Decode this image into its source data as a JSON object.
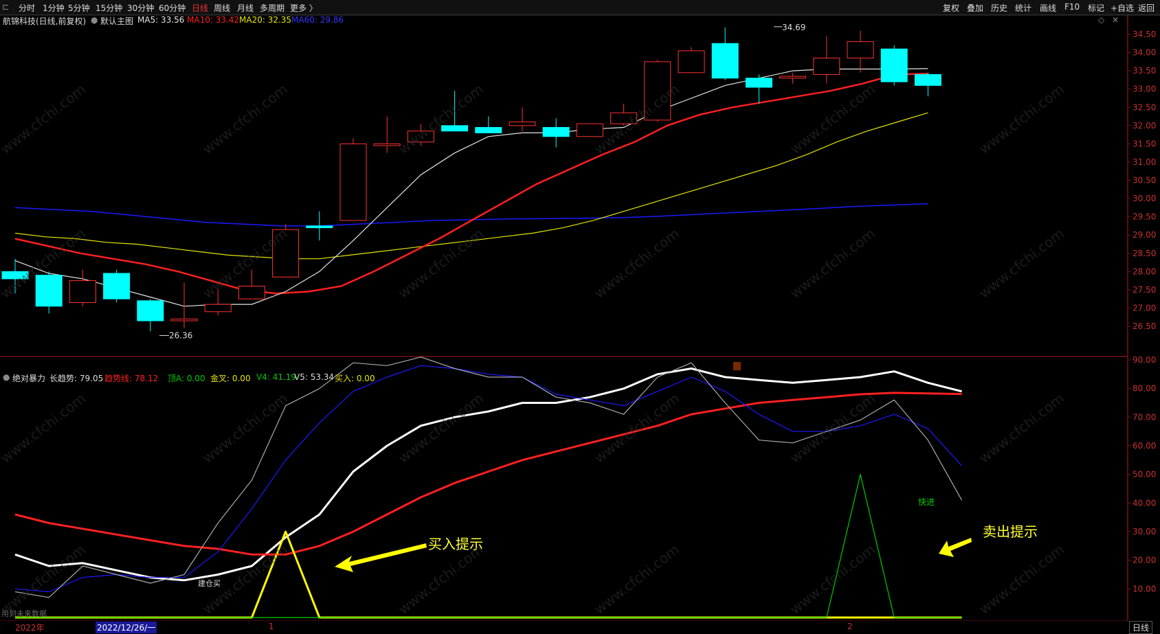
{
  "periods": [
    "分时",
    "1分钟",
    "5分钟",
    "15分钟",
    "30分钟",
    "60分钟",
    "日线",
    "周线",
    "月线",
    "多周期",
    "更多 〉"
  ],
  "active_period": "日线",
  "top_buttons": [
    "复权",
    "叠加",
    "历史",
    "统计",
    "画线",
    "F10",
    "标记",
    "+自选",
    "返回"
  ],
  "stock": {
    "name": "航锦科技(日线,前复权)",
    "main_label": "默认主图",
    "ma5_label": "MA5: 33.56",
    "ma10_label": "MA10: 33.42",
    "ma20_label": "MA20: 32.35",
    "ma60_label": "MA60: 29.86"
  },
  "indicator": {
    "name": "绝对暴力",
    "long_label": "长趋势: 79.05",
    "trend_label": "趋势线: 78.12",
    "top_label": "顶A: 0.00",
    "gold_label": "金叉: 0.00",
    "v4_label": "V4: 41.19",
    "v5_label": "V5: 53.34",
    "buy_label": "买入: 0.00"
  },
  "annotations": {
    "buy_hint": "买入提示",
    "sell_hint": "卖出提示",
    "fast_in": "快进",
    "low_label": "26.36",
    "high_label": "34.69",
    "bottom_note": "用到未来数据",
    "small_label": "建仓买"
  },
  "watermark": "www.cfchi.com",
  "bottom": {
    "year": "2022年",
    "cursor_date": "2022/12/26/一",
    "m1": "1",
    "m2": "2",
    "tab": "日线"
  },
  "colors": {
    "up": "#ff3232",
    "down": "#00ffff",
    "ma5": "#e6e6e6",
    "ma10": "#ff2020",
    "ma20": "#e6e600",
    "ma60": "#1a1aff",
    "grid": "#7a1010",
    "axis_text": "#c83232"
  },
  "chart_data": [
    {
      "type": "candlestick",
      "title": "航锦科技(日线,前复权)",
      "ylim": [
        26.2,
        34.85
      ],
      "yticks": [
        26.5,
        27.0,
        27.5,
        28.0,
        28.5,
        29.0,
        29.5,
        30.0,
        30.5,
        31.0,
        31.5,
        32.0,
        32.5,
        33.0,
        33.5,
        34.0,
        34.5
      ],
      "candles": [
        {
          "o": 28.0,
          "h": 28.35,
          "l": 27.4,
          "c": 27.8
        },
        {
          "o": 27.9,
          "h": 28.0,
          "l": 26.85,
          "c": 27.05
        },
        {
          "o": 27.15,
          "h": 28.05,
          "l": 27.05,
          "c": 27.75
        },
        {
          "o": 27.95,
          "h": 28.05,
          "l": 27.15,
          "c": 27.25
        },
        {
          "o": 27.2,
          "h": 27.25,
          "l": 26.36,
          "c": 26.65
        },
        {
          "o": 26.65,
          "h": 27.7,
          "l": 26.45,
          "c": 26.7
        },
        {
          "o": 26.9,
          "h": 27.5,
          "l": 26.8,
          "c": 27.1
        },
        {
          "o": 27.25,
          "h": 28.05,
          "l": 27.25,
          "c": 27.6
        },
        {
          "o": 27.85,
          "h": 29.3,
          "l": 27.85,
          "c": 29.15
        },
        {
          "o": 29.25,
          "h": 29.65,
          "l": 28.85,
          "c": 29.2
        },
        {
          "o": 29.4,
          "h": 31.65,
          "l": 29.4,
          "c": 31.5
        },
        {
          "o": 31.45,
          "h": 32.25,
          "l": 31.25,
          "c": 31.5
        },
        {
          "o": 31.55,
          "h": 32.05,
          "l": 31.45,
          "c": 31.85
        },
        {
          "o": 32.0,
          "h": 32.95,
          "l": 31.85,
          "c": 31.85
        },
        {
          "o": 31.95,
          "h": 32.25,
          "l": 31.8,
          "c": 31.8
        },
        {
          "o": 32.0,
          "h": 32.5,
          "l": 31.85,
          "c": 32.1
        },
        {
          "o": 31.95,
          "h": 32.2,
          "l": 31.4,
          "c": 31.7
        },
        {
          "o": 31.7,
          "h": 32.05,
          "l": 31.7,
          "c": 32.05
        },
        {
          "o": 32.05,
          "h": 32.6,
          "l": 32.0,
          "c": 32.35
        },
        {
          "o": 32.15,
          "h": 33.8,
          "l": 32.1,
          "c": 33.75
        },
        {
          "o": 33.45,
          "h": 34.15,
          "l": 33.45,
          "c": 34.05
        },
        {
          "o": 34.25,
          "h": 34.69,
          "l": 33.25,
          "c": 33.3
        },
        {
          "o": 33.3,
          "h": 33.4,
          "l": 32.6,
          "c": 33.05
        },
        {
          "o": 33.3,
          "h": 33.45,
          "l": 33.15,
          "c": 33.35
        },
        {
          "o": 33.4,
          "h": 34.45,
          "l": 33.15,
          "c": 33.85
        },
        {
          "o": 33.85,
          "h": 34.6,
          "l": 33.45,
          "c": 34.3
        },
        {
          "o": 34.1,
          "h": 34.2,
          "l": 33.1,
          "c": 33.2
        },
        {
          "o": 33.4,
          "h": 33.45,
          "l": 32.8,
          "c": 33.1
        }
      ],
      "ma5": [
        28.3,
        27.95,
        27.8,
        27.55,
        27.3,
        27.05,
        27.1,
        27.1,
        27.45,
        28.0,
        28.85,
        29.75,
        30.65,
        31.25,
        31.7,
        31.8,
        31.8,
        31.9,
        31.95,
        32.4,
        32.75,
        33.1,
        33.3,
        33.5,
        33.55,
        33.55,
        33.55,
        33.56
      ],
      "ma10": [
        28.9,
        28.7,
        28.5,
        28.35,
        28.2,
        28.0,
        27.75,
        27.5,
        27.4,
        27.45,
        27.6,
        28.0,
        28.45,
        28.9,
        29.4,
        29.9,
        30.4,
        30.8,
        31.2,
        31.55,
        32.0,
        32.3,
        32.5,
        32.65,
        32.8,
        32.95,
        33.15,
        33.4,
        33.42
      ],
      "ma20": [
        29.05,
        28.95,
        28.9,
        28.8,
        28.75,
        28.65,
        28.55,
        28.45,
        28.4,
        28.35,
        28.35,
        28.45,
        28.55,
        28.65,
        28.75,
        28.85,
        28.95,
        29.05,
        29.2,
        29.4,
        29.65,
        29.9,
        30.15,
        30.4,
        30.65,
        30.9,
        31.2,
        31.55,
        31.85,
        32.1,
        32.35
      ],
      "ma60": [
        29.75,
        29.7,
        29.65,
        29.55,
        29.45,
        29.35,
        29.3,
        29.25,
        29.25,
        29.3,
        29.35,
        29.4,
        29.42,
        29.44,
        29.45,
        29.46,
        29.48,
        29.52,
        29.57,
        29.62,
        29.67,
        29.72,
        29.78,
        29.82,
        29.86
      ]
    },
    {
      "type": "line",
      "title": "绝对暴力",
      "ylim": [
        0,
        95
      ],
      "yticks": [
        10,
        20,
        30,
        40,
        50,
        60,
        70,
        80,
        90
      ],
      "series": [
        {
          "name": "长趋势",
          "color": "#ffffff",
          "values": [
            22,
            18,
            19,
            16.5,
            14,
            13,
            15,
            18,
            28,
            36,
            51,
            60,
            67,
            70,
            72,
            75,
            75,
            77,
            80,
            85,
            87,
            84,
            83,
            82,
            83,
            84,
            86,
            82,
            79
          ]
        },
        {
          "name": "趋势线",
          "color": "#ff2020",
          "values": [
            36,
            33,
            31,
            29,
            27,
            25,
            24,
            22,
            22,
            25,
            30,
            36,
            42,
            47,
            51,
            55,
            58,
            61,
            64,
            67,
            71,
            73,
            75,
            76,
            77,
            78,
            78.5,
            78.3,
            78.1
          ]
        },
        {
          "name": "V4",
          "color": "#1a1aff",
          "values": [
            10,
            9,
            14,
            15,
            14,
            14,
            23,
            38,
            55,
            68,
            79,
            84,
            88,
            87,
            85,
            84,
            78,
            76,
            74,
            79,
            84,
            79,
            71,
            65,
            65,
            67,
            71,
            66,
            53
          ]
        },
        {
          "name": "V5",
          "color": "#aaaaaa",
          "values": [
            9,
            7,
            18,
            15,
            12,
            15,
            33,
            48,
            74,
            80,
            89,
            88,
            91,
            87,
            84,
            84,
            77,
            75,
            71,
            84,
            89,
            75,
            62,
            61,
            65,
            69,
            76,
            62,
            41
          ]
        },
        {
          "name": "买入",
          "color": "#ffff00",
          "values": [
            0,
            0,
            0,
            0,
            0,
            0,
            0,
            0,
            30,
            0,
            0,
            0,
            0,
            0,
            0,
            0,
            0,
            0,
            0,
            0,
            0,
            0,
            0,
            0,
            0,
            0,
            0,
            0,
            0
          ]
        },
        {
          "name": "快进",
          "color": "#00cc00",
          "values": [
            0,
            0,
            0,
            0,
            0,
            0,
            0,
            0,
            0,
            0,
            0,
            0,
            0,
            0,
            0,
            0,
            0,
            0,
            0,
            0,
            0,
            0,
            0,
            0,
            0,
            50,
            0,
            0,
            0
          ]
        }
      ]
    }
  ]
}
